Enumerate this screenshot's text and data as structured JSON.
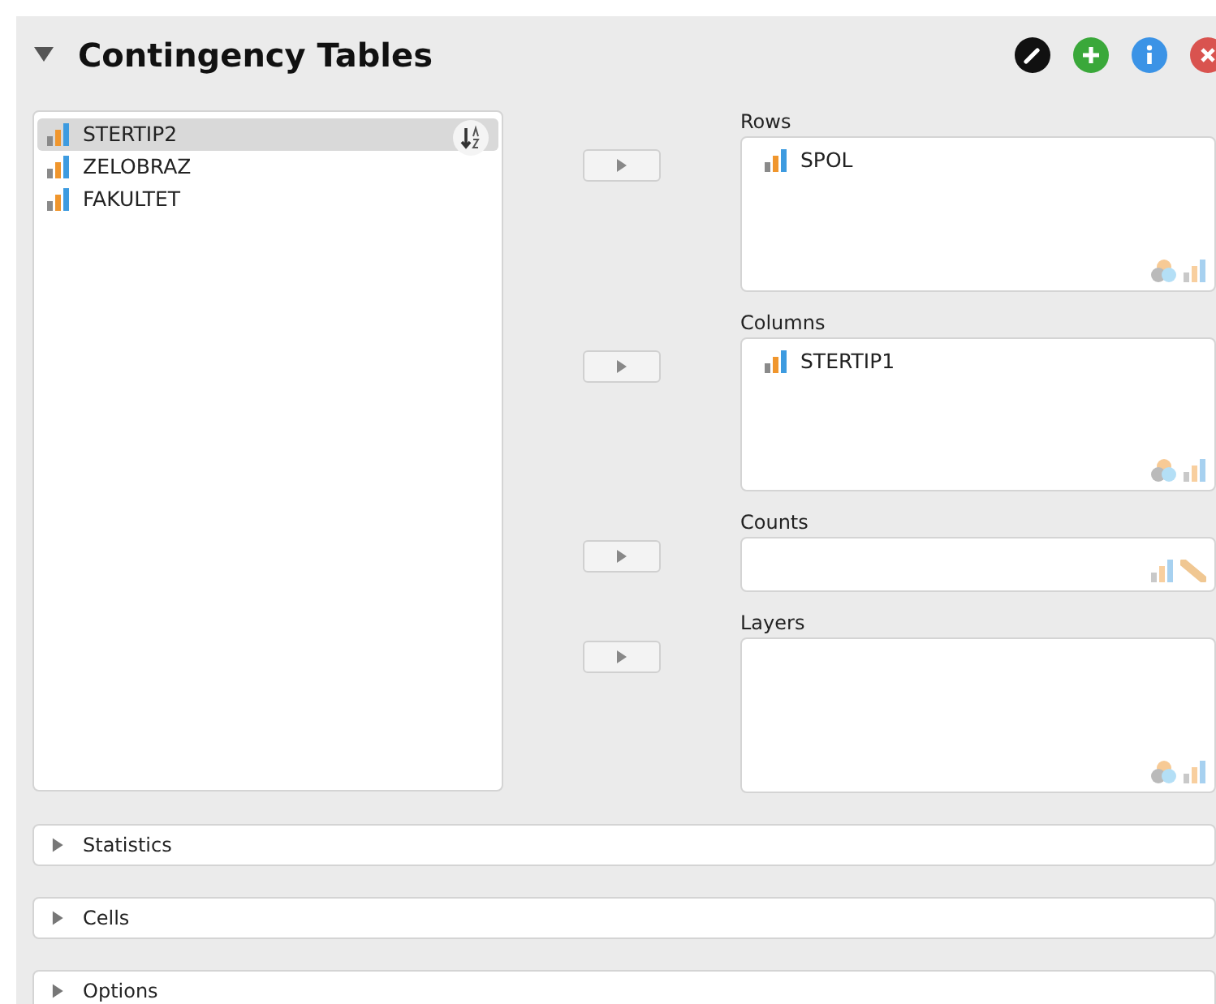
{
  "header": {
    "title": "Contingency Tables",
    "expanded": true
  },
  "source_variables": [
    {
      "name": "STERTIP2",
      "selected": true
    },
    {
      "name": "ZELOBRAZ",
      "selected": false
    },
    {
      "name": "FAKULTET",
      "selected": false
    }
  ],
  "targets": [
    {
      "label": "Rows",
      "kind": "factor",
      "variables": [
        "SPOL"
      ]
    },
    {
      "label": "Columns",
      "kind": "factor",
      "variables": [
        "STERTIP1"
      ]
    },
    {
      "label": "Counts",
      "kind": "count"
    },
    {
      "label": "Layers",
      "kind": "factor"
    }
  ],
  "sections": [
    {
      "label": "Statistics",
      "expanded": false
    },
    {
      "label": "Cells",
      "expanded": false
    },
    {
      "label": "Options",
      "expanded": false
    }
  ]
}
